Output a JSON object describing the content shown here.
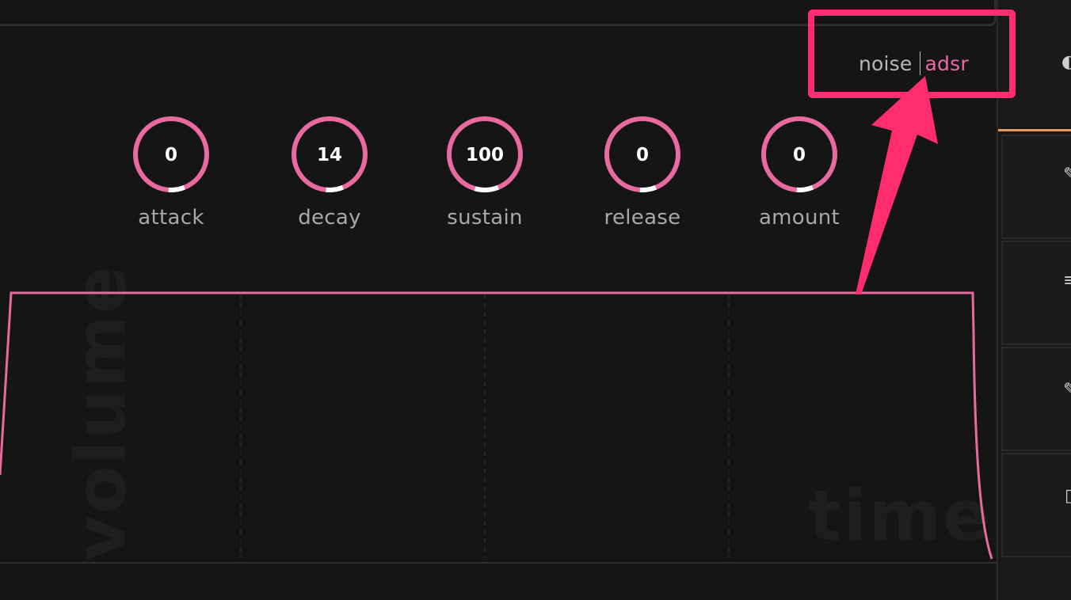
{
  "modes": {
    "noise": "noise",
    "adsr": "adsr",
    "active": "adsr"
  },
  "knobs": [
    {
      "label": "attack",
      "value": "0",
      "level": 0
    },
    {
      "label": "decay",
      "value": "14",
      "level": 14
    },
    {
      "label": "sustain",
      "value": "100",
      "level": 100
    },
    {
      "label": "release",
      "value": "0",
      "level": 0
    },
    {
      "label": "amount",
      "value": "0",
      "level": 0
    }
  ],
  "plot": {
    "y_label": "volume",
    "x_label": "time"
  },
  "colors": {
    "accent": "#e86aa0",
    "annotation": "#ff2d6f",
    "tab_highlight": "#e8975d",
    "background": "#161516"
  },
  "right_panel": {
    "icons": [
      "eye-icon",
      "pencil-icon",
      "menu-icon",
      "pencil-icon",
      "file-icon"
    ]
  }
}
